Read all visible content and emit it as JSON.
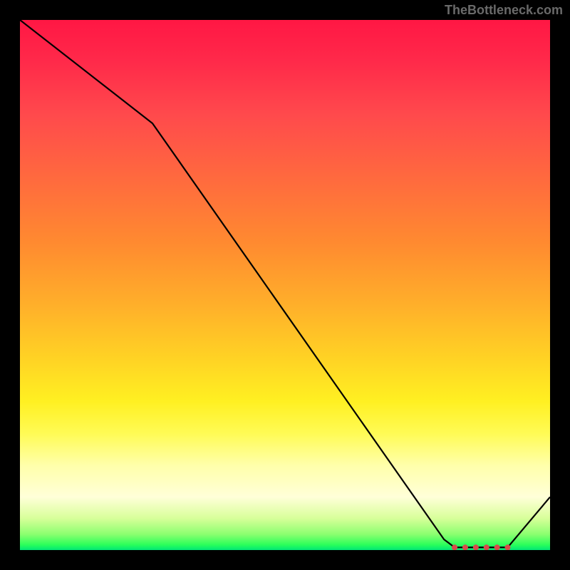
{
  "attribution": "TheBottleneck.com",
  "chart_data": {
    "type": "line",
    "title": "",
    "xlabel": "",
    "ylabel": "",
    "xlim": [
      0,
      100
    ],
    "ylim": [
      0,
      100
    ],
    "x": [
      0,
      25,
      80,
      82,
      90,
      92,
      100
    ],
    "values": [
      100,
      80.5,
      2,
      0.5,
      0.5,
      0.5,
      10
    ],
    "marker_points": {
      "x": [
        82,
        84,
        86,
        88,
        90,
        92
      ],
      "values": [
        0.5,
        0.5,
        0.5,
        0.5,
        0.5,
        0.5
      ]
    },
    "colors": {
      "line": "#000000",
      "marker": "#d94a4a",
      "background_top": "#ff1744",
      "background_bottom": "#00e676"
    }
  }
}
